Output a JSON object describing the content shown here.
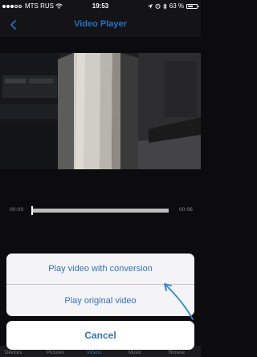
{
  "status_bar": {
    "carrier": "MTS RUS",
    "time": "19:53",
    "battery_percent_label": "63 %",
    "battery_level": 0.63,
    "signal_bars_filled": 3,
    "signal_bars_total": 5
  },
  "nav": {
    "title": "Video Player",
    "back_icon": "chevron-left-icon"
  },
  "player": {
    "elapsed": "00:00",
    "duration": "00:06",
    "progress": 0.0
  },
  "action_sheet": {
    "play_with_conversion_label": "Play video with conversion",
    "play_original_label": "Play original video",
    "cancel_label": "Cancel"
  },
  "tab_bar": {
    "tabs": [
      {
        "label": "Devices"
      },
      {
        "label": "Pictures"
      },
      {
        "label": "Videos"
      },
      {
        "label": "Music"
      },
      {
        "label": "Browse"
      }
    ]
  },
  "colors": {
    "accent": "#2f73c9",
    "background": "#0c0c0e",
    "sheet": "#f4f4f6",
    "annotation_arrow": "#2a8ad4"
  }
}
